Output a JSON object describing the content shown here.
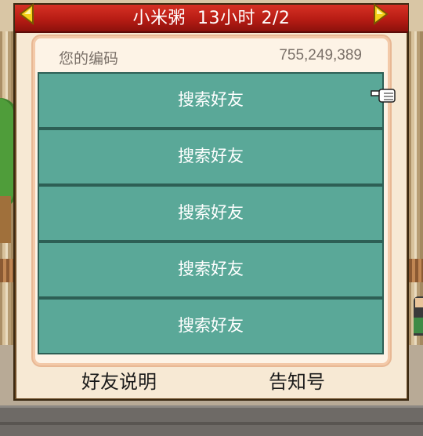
{
  "dialog": {
    "title": "小米粥  13小时 2/2"
  },
  "code": {
    "label": "您的编码",
    "value": "755,249,389"
  },
  "slots": [
    {
      "label": "搜索好友"
    },
    {
      "label": "搜索好友"
    },
    {
      "label": "搜索好友"
    },
    {
      "label": "搜索好友"
    },
    {
      "label": "搜索好友"
    }
  ],
  "footer": {
    "explain_label": "好友说明",
    "notice_label": "告知号"
  },
  "icons": {
    "prev": "arrow-left-icon",
    "next": "arrow-right-icon",
    "pointer": "hand-pointer-icon"
  },
  "colors": {
    "title_red": "#c0241a",
    "slot_teal": "#5aa898",
    "panel_bg": "#fdf3e6",
    "arrow_yellow": "#f5d21a"
  }
}
